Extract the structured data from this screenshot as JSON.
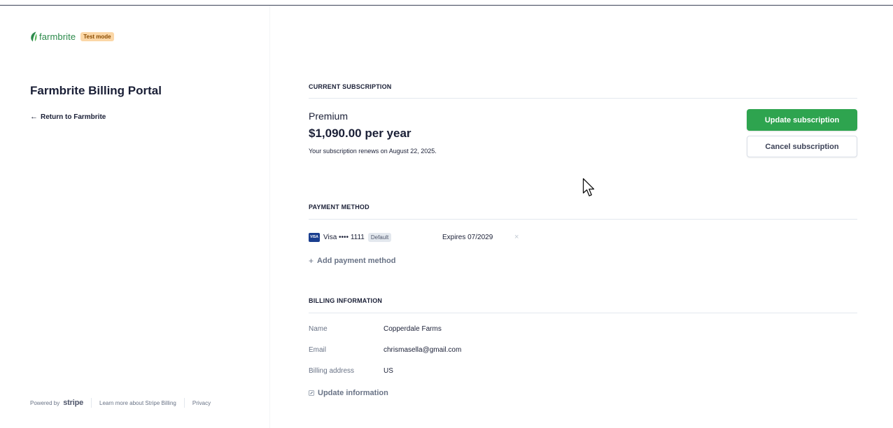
{
  "brand": {
    "name": "farmbrite",
    "test_badge": "Test mode",
    "accent_color": "#2c8a4b",
    "leaf_icon": "leaf-icon"
  },
  "sidebar": {
    "title": "Farmbrite Billing Portal",
    "return_arrow": "←",
    "return_label": "Return to Farmbrite"
  },
  "footer": {
    "powered_by": "Powered by",
    "stripe": "stripe",
    "learn_more": "Learn more about Stripe Billing",
    "privacy": "Privacy"
  },
  "subscription": {
    "section_title": "CURRENT SUBSCRIPTION",
    "plan": "Premium",
    "price": "$1,090.00 per year",
    "renews": "Your subscription renews on August 22, 2025.",
    "update_button": "Update subscription",
    "cancel_button": "Cancel subscription",
    "primary_color": "#2ea44f"
  },
  "payment": {
    "section_title": "PAYMENT METHOD",
    "card_brand_icon": "VISA",
    "card": "Visa •••• 1111",
    "default_badge": "Default",
    "expires": "Expires 07/2029",
    "remove_icon": "×",
    "add_plus": "+",
    "add_label": "Add payment method"
  },
  "billing": {
    "section_title": "BILLING INFORMATION",
    "rows": [
      {
        "label": "Name",
        "value": "Copperdale Farms"
      },
      {
        "label": "Email",
        "value": "chrismasella@gmail.com"
      },
      {
        "label": "Billing address",
        "value": "US"
      }
    ],
    "update_label": "Update information"
  }
}
